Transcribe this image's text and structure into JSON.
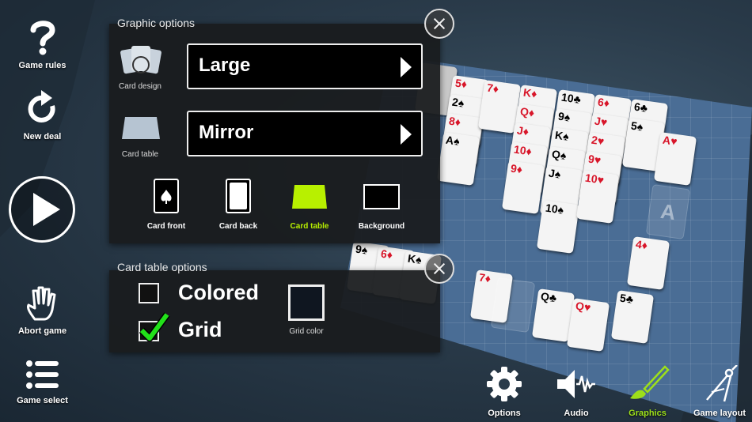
{
  "sidebar": {
    "game_rules": "Game rules",
    "new_deal": "New deal",
    "abort_game": "Abort game",
    "game_select": "Game select"
  },
  "graphic_options": {
    "title": "Graphic options",
    "card_design_label": "Card design",
    "card_design_value": "Large",
    "card_table_label": "Card table",
    "card_table_value": "Mirror",
    "tiles": [
      {
        "label": "Card front",
        "selected": false
      },
      {
        "label": "Card back",
        "selected": false
      },
      {
        "label": "Card table",
        "selected": true
      },
      {
        "label": "Background",
        "selected": false
      }
    ],
    "selected_color": "#b8f000"
  },
  "card_table_options": {
    "title": "Card table options",
    "colored_label": "Colored",
    "colored_checked": false,
    "grid_label": "Grid",
    "grid_checked": true,
    "grid_color_label": "Grid color",
    "grid_color_value": "#0f1620"
  },
  "bottom_bar": {
    "options": "Options",
    "audio": "Audio",
    "graphics": "Graphics",
    "game_layout": "Game layout",
    "active_color": "#9de01a"
  },
  "table_cards": {
    "tableau": [
      [
        "5♦",
        "2♠",
        "8♦",
        "A♠"
      ],
      [
        "7♦"
      ],
      [
        "K♦",
        "Q♦",
        "J♦",
        "10♦",
        "9♦"
      ],
      [
        "10♣",
        "9♠",
        "K♠",
        "Q♠",
        "J♠",
        "10♠"
      ],
      [
        "6♦",
        "J♥",
        "2♥",
        "9♥",
        "10♥"
      ],
      [
        "6♣",
        "5♠"
      ]
    ],
    "foundations": [
      "A♥",
      "A",
      "4♦",
      "5♣"
    ],
    "bottom_row": [
      "9♠",
      "6♦",
      "K♠",
      "7♦",
      "Q♣",
      "Q♥"
    ]
  }
}
